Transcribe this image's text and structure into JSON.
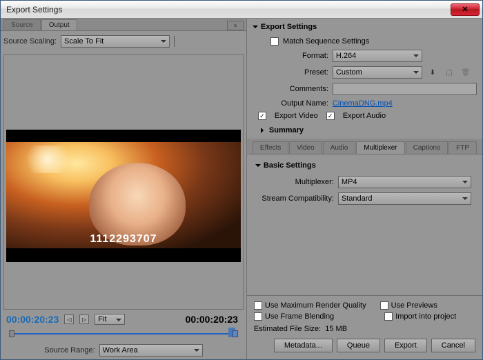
{
  "window": {
    "title": "Export Settings"
  },
  "left": {
    "tabs": {
      "source": "Source",
      "output": "Output"
    },
    "scaling_label": "Source Scaling:",
    "scaling_value": "Scale To Fit",
    "watermark": "1112293707",
    "tc_in": "00:00:20:23",
    "tc_out": "00:00:20:23",
    "fit": "Fit",
    "range_label": "Source Range:",
    "range_value": "Work Area"
  },
  "export": {
    "header": "Export Settings",
    "match_seq": "Match Sequence Settings",
    "format_label": "Format:",
    "format_value": "H.264",
    "preset_label": "Preset:",
    "preset_value": "Custom",
    "comments_label": "Comments:",
    "comments_value": "",
    "outname_label": "Output Name:",
    "outname_value": "CinemaDNG.mp4",
    "export_video": "Export Video",
    "export_audio": "Export Audio",
    "summary": "Summary"
  },
  "rtabs": {
    "effects": "Effects",
    "video": "Video",
    "audio": "Audio",
    "multiplexer": "Multiplexer",
    "captions": "Captions",
    "ftp": "FTP"
  },
  "basic": {
    "header": "Basic Settings",
    "mux_label": "Multiplexer:",
    "mux_value": "MP4",
    "stream_label": "Stream Compatibility:",
    "stream_value": "Standard"
  },
  "bottom": {
    "max_quality": "Use Maximum Render Quality",
    "use_previews": "Use Previews",
    "frame_blend": "Use Frame Blending",
    "import_proj": "Import into project",
    "est_label": "Estimated File Size:",
    "est_value": "15 MB",
    "metadata": "Metadata...",
    "queue": "Queue",
    "export": "Export",
    "cancel": "Cancel"
  }
}
